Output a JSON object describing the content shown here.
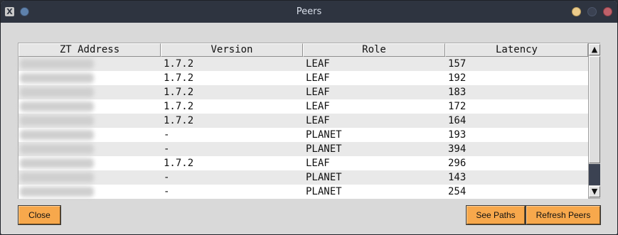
{
  "window": {
    "title": "Peers"
  },
  "titlebar": {
    "app_icon_glyph": "X"
  },
  "table": {
    "headers": [
      "ZT Address",
      "Version",
      "Role",
      "Latency"
    ],
    "rows": [
      {
        "version": "1.7.2",
        "role": "LEAF",
        "latency": "157"
      },
      {
        "version": "1.7.2",
        "role": "LEAF",
        "latency": "192"
      },
      {
        "version": "1.7.2",
        "role": "LEAF",
        "latency": "183"
      },
      {
        "version": "1.7.2",
        "role": "LEAF",
        "latency": "172"
      },
      {
        "version": "1.7.2",
        "role": "LEAF",
        "latency": "164"
      },
      {
        "version": "-",
        "role": "PLANET",
        "latency": "193"
      },
      {
        "version": "-",
        "role": "PLANET",
        "latency": "394"
      },
      {
        "version": "1.7.2",
        "role": "LEAF",
        "latency": "296"
      },
      {
        "version": "-",
        "role": "PLANET",
        "latency": "143"
      },
      {
        "version": "-",
        "role": "PLANET",
        "latency": "254"
      }
    ]
  },
  "scrollbar": {
    "up_glyph": "▲",
    "down_glyph": "▼"
  },
  "buttons": {
    "close": "Close",
    "see_paths": "See Paths",
    "refresh_peers": "Refresh Peers"
  },
  "colors": {
    "button": "#f7a84c",
    "titlebar": "#2e3440",
    "window_bg": "#d9d9d9"
  }
}
